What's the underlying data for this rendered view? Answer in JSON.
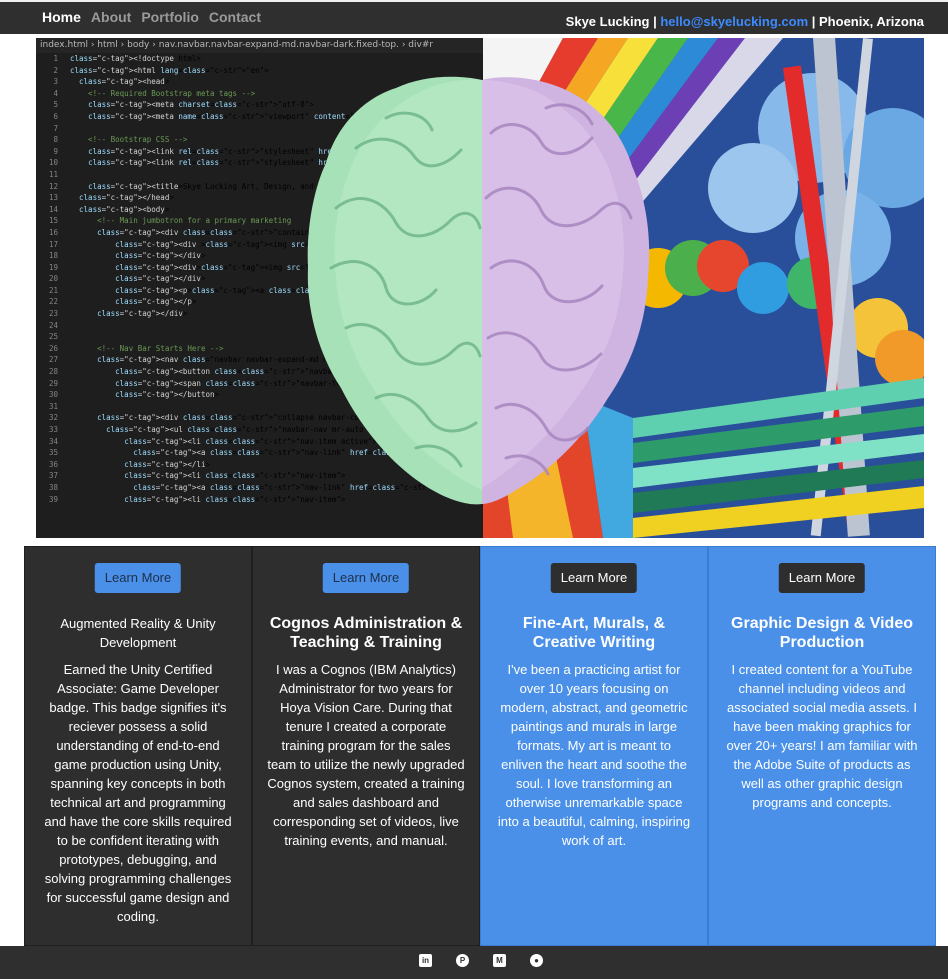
{
  "nav": {
    "links": [
      "Home",
      "About",
      "Portfolio",
      "Contact"
    ],
    "active": "Home",
    "name": "Skye Lucking",
    "separator": " | ",
    "email": "hello@skyelucking.com",
    "location": "Phoenix, Arizona"
  },
  "hero": {
    "breadcrumb": "index.html  ›  html  ›  body  ›  nav.navbar.navbar-expand-md.navbar-dark.fixed-top.  ›  div#r",
    "code_lines": [
      {
        "n": "1",
        "t": "<!doctype html>"
      },
      {
        "n": "2",
        "t": "<html lang=\"en\">"
      },
      {
        "n": "3",
        "t": "  <head>"
      },
      {
        "n": "4",
        "t": "    <!-- Required Bootstrap meta tags -->"
      },
      {
        "n": "5",
        "t": "    <meta charset=\"utf-8\">"
      },
      {
        "n": "6",
        "t": "    <meta name=\"viewport\" content=\"width=device-width, init"
      },
      {
        "n": "7",
        "t": ""
      },
      {
        "n": "8",
        "t": "    <!-- Bootstrap CSS -->"
      },
      {
        "n": "9",
        "t": "    <link rel=\"stylesheet\" href=\"https://cdn.jsdelivr"
      },
      {
        "n": "10",
        "t": "    <link rel=\"stylesheet\" href=\"style.css\">"
      },
      {
        "n": "11",
        "t": ""
      },
      {
        "n": "12",
        "t": "    <title>Skye Lucking Art, Design, and Technology"
      },
      {
        "n": "13",
        "t": "  </head>"
      },
      {
        "n": "14",
        "t": "  <body>"
      },
      {
        "n": "15",
        "t": "      <!-- Main jumbotron for a primary marketing"
      },
      {
        "n": "16",
        "t": "      <div class=\"container-sm\" >"
      },
      {
        "n": "17",
        "t": "          <div ><img src=\"Assets/Images/skye-he"
      },
      {
        "n": "18",
        "t": "          </div>"
      },
      {
        "n": "19",
        "t": "          <div><img src=\"Assets/Images/skye-port"
      },
      {
        "n": "20",
        "t": "          </div>"
      },
      {
        "n": "21",
        "t": "          <p><a class=\"btn btn-primary btn-lg\" st"
      },
      {
        "n": "22",
        "t": "          </p>"
      },
      {
        "n": "23",
        "t": "      </div>"
      },
      {
        "n": "24",
        "t": ""
      },
      {
        "n": "25",
        "t": ""
      },
      {
        "n": "26",
        "t": "      <!-- Nav Bar Starts Here -->"
      },
      {
        "n": "27",
        "t": "      <nav class=\"navbar navbar-expand-md navbar-dark fix"
      },
      {
        "n": "28",
        "t": "          <button class=\"navbar-toggler\" type=\"button\" data"
      },
      {
        "n": "29",
        "t": "          <span class=\"navbar-toggler-icon\"></span>"
      },
      {
        "n": "30",
        "t": "          </button>"
      },
      {
        "n": "31",
        "t": ""
      },
      {
        "n": "32",
        "t": "      <div class=\"collapse navbar-collapse\" id=\"navbarsExampleD"
      },
      {
        "n": "33",
        "t": "        <ul class=\"navbar-nav mr-auto\">"
      },
      {
        "n": "34",
        "t": "            <li class=\"nav-item active\">"
      },
      {
        "n": "35",
        "t": "              <a class=\"nav-link\" href=\"index.html\">Home <span class=\""
      },
      {
        "n": "36",
        "t": "            </li>"
      },
      {
        "n": "37",
        "t": "            <li class=\"nav-item\">"
      },
      {
        "n": "38",
        "t": "              <a class=\"nav-link\" href=\"About.html\">About</a>"
      },
      {
        "n": "39",
        "t": "            <li class=\"nav-item\">"
      }
    ]
  },
  "cards": [
    {
      "button": "Learn More",
      "title": "Augmented Reality & Unity Development",
      "text": "Earned the Unity Certified Associate: Game Developer badge. This badge signifies it's reciever possess a solid understanding of end-to-end game production using Unity, spanning key concepts in both technical art and programming and have the core skills required to be confident iterating with prototypes, debugging, and solving programming challenges for successful game design and coding."
    },
    {
      "button": "Learn More",
      "title": "Cognos Administration & Teaching & Training",
      "text": "I was a Cognos (IBM Analytics) Administrator for two years for Hoya Vision Care. During that tenure I created a corporate training program for the sales team to utilize the newly upgraded Cognos system, created a training and sales dashboard and corresponding set of videos, live training events, and manual."
    },
    {
      "button": "Learn More",
      "title": "Fine-Art, Murals, & Creative Writing",
      "text": "I've been a practicing artist for over 10 years focusing on modern, abstract, and geometric paintings and murals in large formats. My art is meant to enliven the heart and soothe the soul. I love transforming an otherwise unremarkable space into a beautiful, calming, inspiring work of art."
    },
    {
      "button": "Learn More",
      "title": "Graphic Design & Video Production",
      "text": "I created content for a YouTube channel including videos and associated social media assets. I have been making graphics for over 20+ years! I am familiar with the Adobe Suite of products as well as other graphic design programs and concepts."
    }
  ],
  "footer": {
    "icons": [
      "linkedin-icon",
      "pinterest-icon",
      "medium-icon",
      "github-icon"
    ],
    "glyphs": [
      "in",
      "P",
      "M",
      "●"
    ]
  },
  "colors": {
    "nav_bg": "#2f2f2f",
    "card_dark": "#2e2e2e",
    "card_blue": "#4a90e8",
    "link_blue": "#3d8bff"
  }
}
